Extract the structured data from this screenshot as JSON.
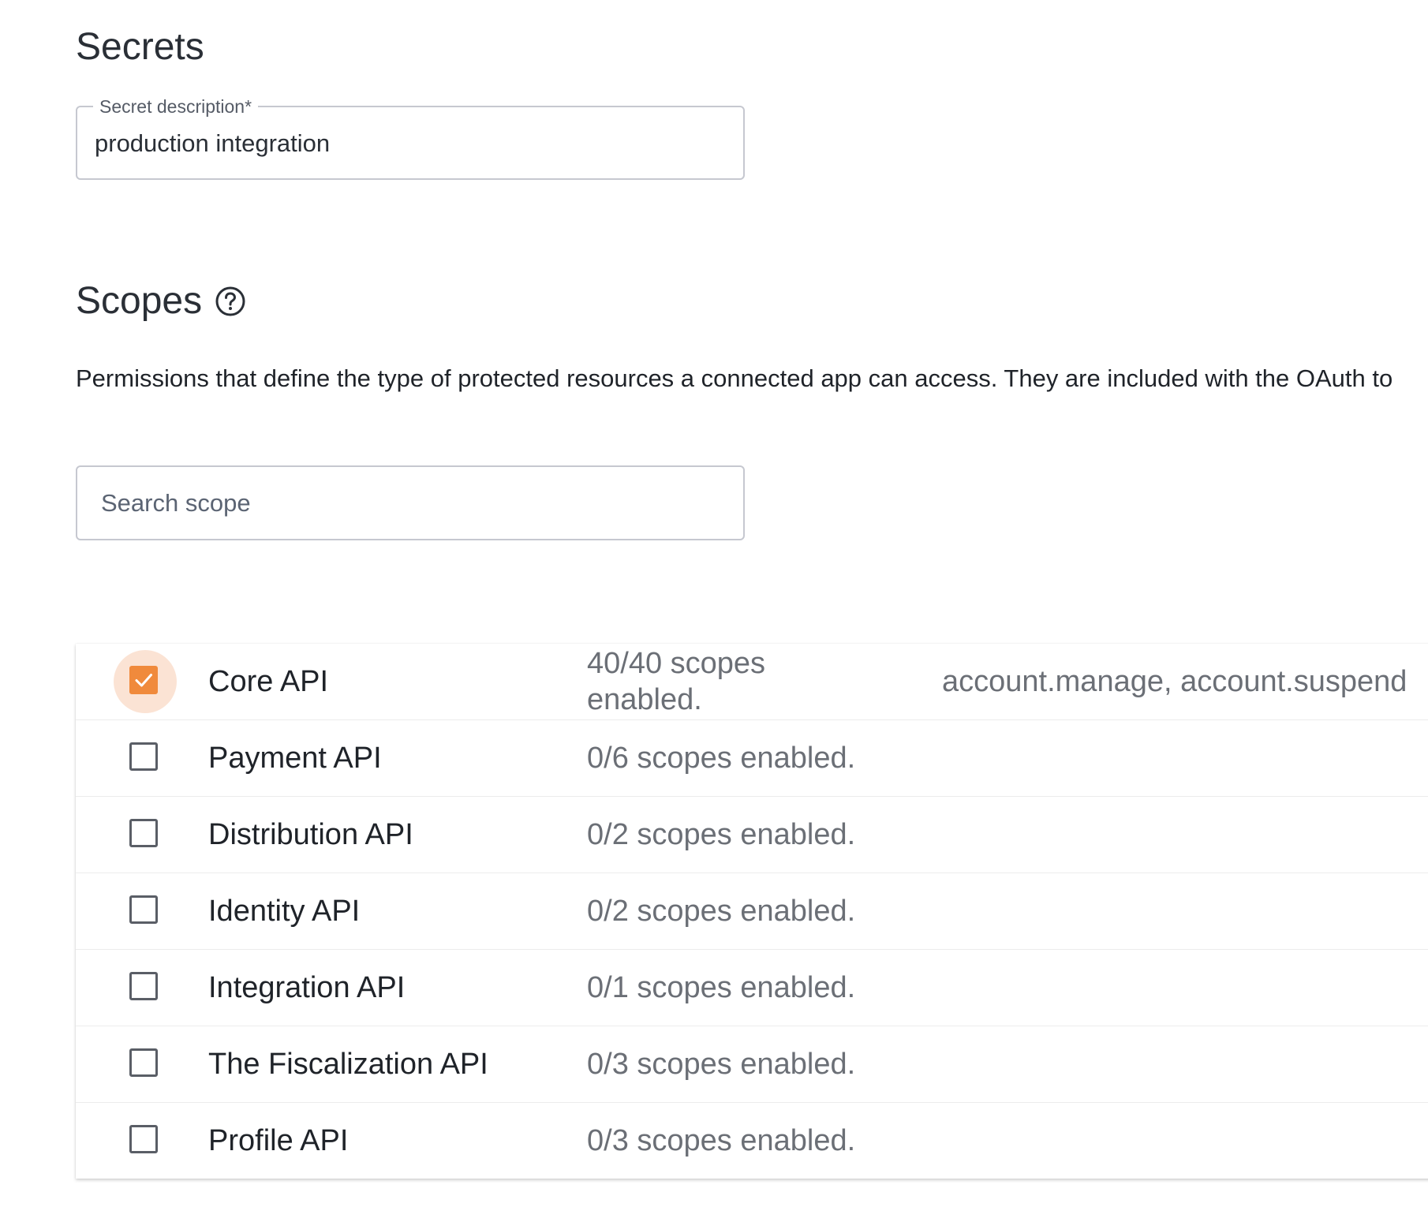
{
  "secrets": {
    "title": "Secrets",
    "field_label": "Secret description*",
    "field_value": "production integration"
  },
  "scopes": {
    "title": "Scopes",
    "help_icon": "question-circle-icon",
    "description": "Permissions that define the type of protected resources a connected app can access. They are included with the OAuth to",
    "search_placeholder": "Search scope",
    "accent_color": "#f08a3c",
    "rows": [
      {
        "name": "Core API",
        "count": "40/40 scopes enabled.",
        "list": "account.manage, account.suspend",
        "checked": true
      },
      {
        "name": "Payment API",
        "count": "0/6 scopes enabled.",
        "list": "",
        "checked": false
      },
      {
        "name": "Distribution API",
        "count": "0/2 scopes enabled.",
        "list": "",
        "checked": false
      },
      {
        "name": "Identity API",
        "count": "0/2 scopes enabled.",
        "list": "",
        "checked": false
      },
      {
        "name": "Integration API",
        "count": "0/1 scopes enabled.",
        "list": "",
        "checked": false
      },
      {
        "name": "The Fiscalization API",
        "count": "0/3 scopes enabled.",
        "list": "",
        "checked": false
      },
      {
        "name": "Profile API",
        "count": "0/3 scopes enabled.",
        "list": "",
        "checked": false
      }
    ]
  }
}
